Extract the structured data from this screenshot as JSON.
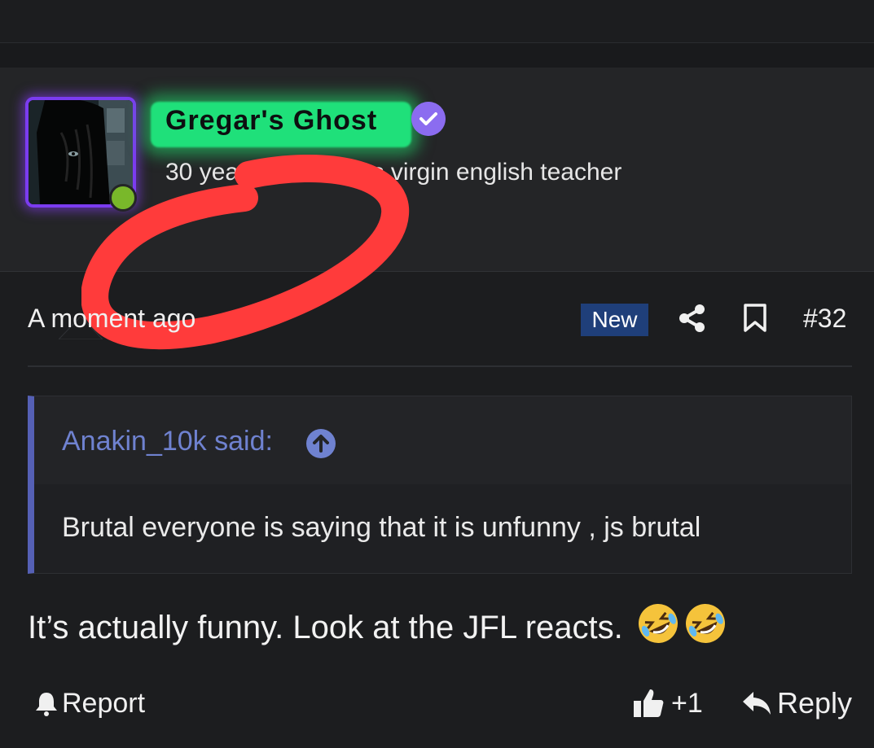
{
  "post": {
    "username": "Gregar's Ghost",
    "user_title": "30 year old dateless virgin english teacher",
    "timestamp": "A moment ago",
    "new_badge": "New",
    "post_number": "#32",
    "quote": {
      "author_label": "Anakin_10k said:",
      "text": "Brutal everyone is saying that it is unfunny , js brutal"
    },
    "message": "It’s actually funny. Look at the JFL reacts.",
    "emojis": [
      "rolling-on-floor-laughing-icon",
      "rolling-on-floor-laughing-icon"
    ]
  },
  "footer": {
    "report_label": "Report",
    "like_count": "+1",
    "reply_label": "Reply"
  },
  "colors": {
    "background": "#1c1d1f",
    "avatar_border": "#7b3cf0",
    "username_highlight": "#1fe07a",
    "verified_badge": "#8b6cf0",
    "quote_accent": "#5560b5",
    "new_badge": "#1f3f7a",
    "online": "#79b82a",
    "scribble": "#ff3b3b"
  }
}
